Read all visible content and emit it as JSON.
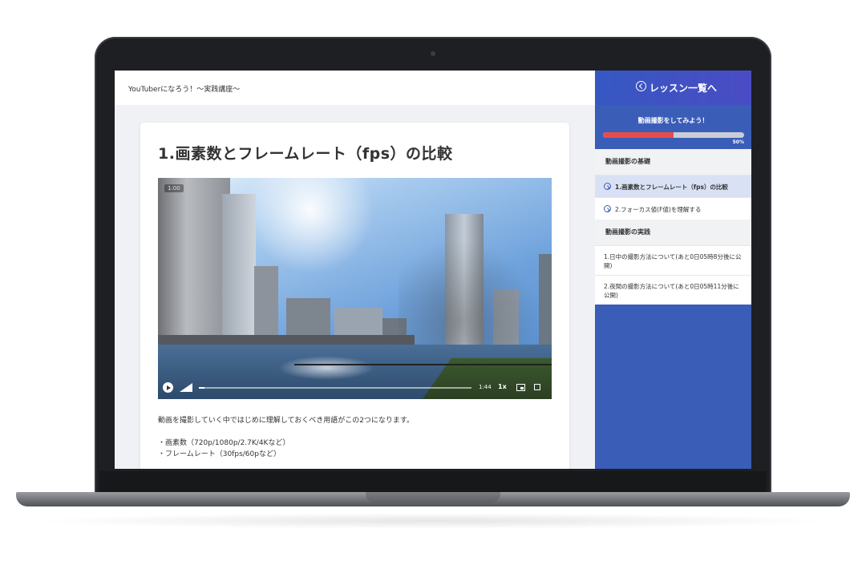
{
  "header": {
    "site_title": "YouTuberになろう！〜実践講座〜"
  },
  "lesson": {
    "title": "1.画素数とフレームレート（fps）の比較",
    "description": "動画を撮影していく中ではじめに理解しておくべき用語がこの2つになります。",
    "bullets": [
      "・画素数（720p/1080p/2.7K/4Kなど）",
      "・フレームレート（30fps/60pなど）"
    ]
  },
  "video": {
    "timecode": "1:00",
    "duration": "1:44",
    "speed": "1x",
    "played_fraction": 0.02,
    "icons": [
      "play-icon",
      "volume-icon",
      "pip-icon",
      "fullscreen-icon"
    ]
  },
  "sidebar": {
    "back_label": "レッスン一覧へ",
    "course_name": "動画撮影をしてみよう！",
    "progress_percent": 50,
    "progress_label": "50%",
    "accent_color": "#3a5db8",
    "progress_color": "#e74c4c",
    "sections": [
      {
        "heading": "動画撮影の基礎",
        "items": [
          {
            "label": "1.画素数とフレームレート（fps）の比較",
            "active": true
          },
          {
            "label": "2.フォーカス値(F値)を理解する",
            "active": false
          }
        ]
      },
      {
        "heading": "動画撮影の実践",
        "items": [
          {
            "label": "1.日中の撮影方法について(あと0日05時8分後に公開)"
          },
          {
            "label": "2.夜間の撮影方法について(あと0日05時11分後に公開)"
          }
        ]
      }
    ]
  }
}
